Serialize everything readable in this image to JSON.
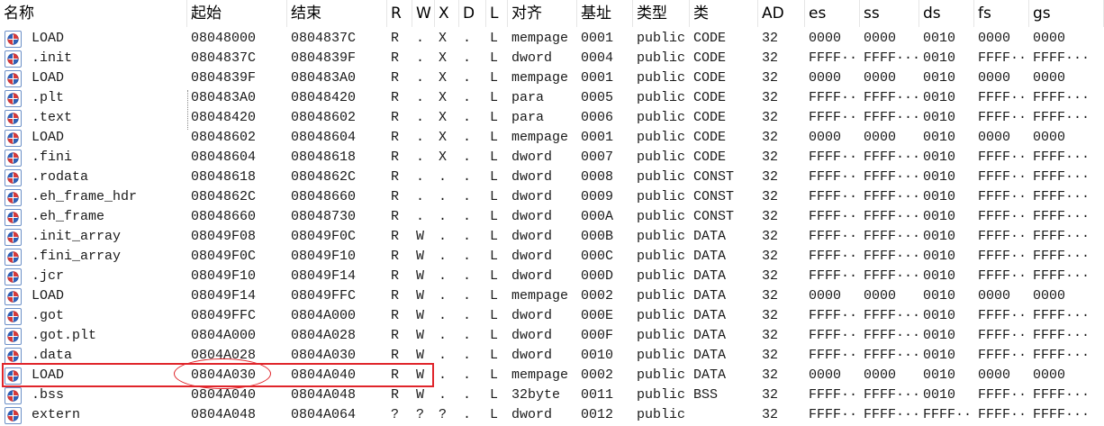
{
  "columns": [
    "名称",
    "起始",
    "结束",
    "R",
    "W",
    "X",
    "D",
    "L",
    "对齐",
    "基址",
    "类型",
    "类",
    "AD",
    "es",
    "ss",
    "ds",
    "fs",
    "gs"
  ],
  "rows": [
    [
      "LOAD",
      "08048000",
      "0804837C",
      "R",
      ".",
      "X",
      ".",
      "L",
      "mempage",
      "0001",
      "public",
      "CODE",
      "32",
      "0000",
      "0000",
      "0010",
      "0000",
      "0000"
    ],
    [
      ".init",
      "0804837C",
      "0804839F",
      "R",
      ".",
      "X",
      ".",
      "L",
      "dword",
      "0004",
      "public",
      "CODE",
      "32",
      "FFFF···",
      "FFFF···",
      "0010",
      "FFFF···",
      "FFFF···"
    ],
    [
      "LOAD",
      "0804839F",
      "080483A0",
      "R",
      ".",
      "X",
      ".",
      "L",
      "mempage",
      "0001",
      "public",
      "CODE",
      "32",
      "0000",
      "0000",
      "0010",
      "0000",
      "0000"
    ],
    [
      ".plt",
      "080483A0",
      "08048420",
      "R",
      ".",
      "X",
      ".",
      "L",
      "para",
      "0005",
      "public",
      "CODE",
      "32",
      "FFFF···",
      "FFFF···",
      "0010",
      "FFFF···",
      "FFFF···"
    ],
    [
      ".text",
      "08048420",
      "08048602",
      "R",
      ".",
      "X",
      ".",
      "L",
      "para",
      "0006",
      "public",
      "CODE",
      "32",
      "FFFF···",
      "FFFF···",
      "0010",
      "FFFF···",
      "FFFF···"
    ],
    [
      "LOAD",
      "08048602",
      "08048604",
      "R",
      ".",
      "X",
      ".",
      "L",
      "mempage",
      "0001",
      "public",
      "CODE",
      "32",
      "0000",
      "0000",
      "0010",
      "0000",
      "0000"
    ],
    [
      ".fini",
      "08048604",
      "08048618",
      "R",
      ".",
      "X",
      ".",
      "L",
      "dword",
      "0007",
      "public",
      "CODE",
      "32",
      "FFFF···",
      "FFFF···",
      "0010",
      "FFFF···",
      "FFFF···"
    ],
    [
      ".rodata",
      "08048618",
      "0804862C",
      "R",
      ".",
      ".",
      ".",
      "L",
      "dword",
      "0008",
      "public",
      "CONST",
      "32",
      "FFFF···",
      "FFFF···",
      "0010",
      "FFFF···",
      "FFFF···"
    ],
    [
      ".eh_frame_hdr",
      "0804862C",
      "08048660",
      "R",
      ".",
      ".",
      ".",
      "L",
      "dword",
      "0009",
      "public",
      "CONST",
      "32",
      "FFFF···",
      "FFFF···",
      "0010",
      "FFFF···",
      "FFFF···"
    ],
    [
      ".eh_frame",
      "08048660",
      "08048730",
      "R",
      ".",
      ".",
      ".",
      "L",
      "dword",
      "000A",
      "public",
      "CONST",
      "32",
      "FFFF···",
      "FFFF···",
      "0010",
      "FFFF···",
      "FFFF···"
    ],
    [
      ".init_array",
      "08049F08",
      "08049F0C",
      "R",
      "W",
      ".",
      ".",
      "L",
      "dword",
      "000B",
      "public",
      "DATA",
      "32",
      "FFFF···",
      "FFFF···",
      "0010",
      "FFFF···",
      "FFFF···"
    ],
    [
      ".fini_array",
      "08049F0C",
      "08049F10",
      "R",
      "W",
      ".",
      ".",
      "L",
      "dword",
      "000C",
      "public",
      "DATA",
      "32",
      "FFFF···",
      "FFFF···",
      "0010",
      "FFFF···",
      "FFFF···"
    ],
    [
      ".jcr",
      "08049F10",
      "08049F14",
      "R",
      "W",
      ".",
      ".",
      "L",
      "dword",
      "000D",
      "public",
      "DATA",
      "32",
      "FFFF···",
      "FFFF···",
      "0010",
      "FFFF···",
      "FFFF···"
    ],
    [
      "LOAD",
      "08049F14",
      "08049FFC",
      "R",
      "W",
      ".",
      ".",
      "L",
      "mempage",
      "0002",
      "public",
      "DATA",
      "32",
      "0000",
      "0000",
      "0010",
      "0000",
      "0000"
    ],
    [
      ".got",
      "08049FFC",
      "0804A000",
      "R",
      "W",
      ".",
      ".",
      "L",
      "dword",
      "000E",
      "public",
      "DATA",
      "32",
      "FFFF···",
      "FFFF···",
      "0010",
      "FFFF···",
      "FFFF···"
    ],
    [
      ".got.plt",
      "0804A000",
      "0804A028",
      "R",
      "W",
      ".",
      ".",
      "L",
      "dword",
      "000F",
      "public",
      "DATA",
      "32",
      "FFFF···",
      "FFFF···",
      "0010",
      "FFFF···",
      "FFFF···"
    ],
    [
      ".data",
      "0804A028",
      "0804A030",
      "R",
      "W",
      ".",
      ".",
      "L",
      "dword",
      "0010",
      "public",
      "DATA",
      "32",
      "FFFF···",
      "FFFF···",
      "0010",
      "FFFF···",
      "FFFF···"
    ],
    [
      "LOAD",
      "0804A030",
      "0804A040",
      "R",
      "W",
      ".",
      ".",
      "L",
      "mempage",
      "0002",
      "public",
      "DATA",
      "32",
      "0000",
      "0000",
      "0010",
      "0000",
      "0000"
    ],
    [
      ".bss",
      "0804A040",
      "0804A048",
      "R",
      "W",
      ".",
      ".",
      "L",
      "32byte",
      "0011",
      "public",
      "BSS",
      "32",
      "FFFF···",
      "FFFF···",
      "0010",
      "FFFF···",
      "FFFF···"
    ],
    [
      "extern",
      "0804A048",
      "0804A064",
      "?",
      "?",
      "?",
      ".",
      "L",
      "dword",
      "0012",
      "public",
      "",
      "32",
      "FFFF···",
      "FFFF···",
      "FFFF···",
      "FFFF···",
      "FFFF···"
    ]
  ],
  "icon": "segment-icon",
  "highlighted_row": 17,
  "colors": {
    "highlight": "#e0252b",
    "icon_border": "#6b8fc7",
    "icon_red": "#d43a3a",
    "icon_blue": "#2f5fb3"
  }
}
